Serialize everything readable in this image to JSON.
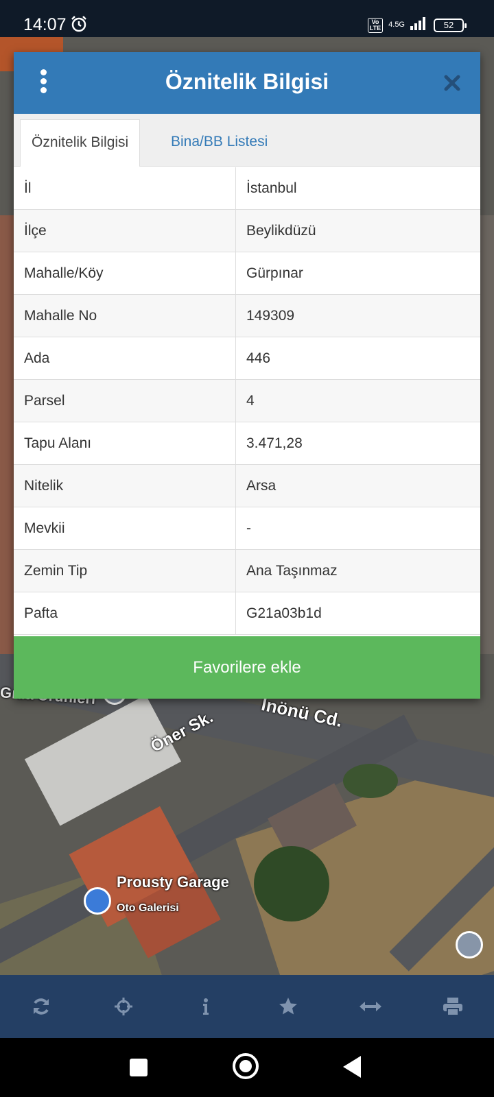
{
  "status_bar": {
    "time": "14:07",
    "alarm_icon": "alarm-clock-icon",
    "volte": "Vo\nLTE",
    "network": "4.5G",
    "battery": "52"
  },
  "map": {
    "labels": {
      "gida": "Gıda Ürünleri",
      "oner": "Öner Sk.",
      "inonu": "İnönü Cd.",
      "prousty": "Prousty Garage",
      "oto": "Oto Galerisi"
    }
  },
  "dialog": {
    "title": "Öznitelik Bilgisi",
    "menu_icon": "more-vertical-icon",
    "close_icon": "close-icon",
    "tabs": [
      {
        "label": "Öznitelik Bilgisi",
        "active": true
      },
      {
        "label": "Bina/BB Listesi",
        "active": false
      }
    ],
    "rows": [
      {
        "key": "İl",
        "value": "İstanbul"
      },
      {
        "key": "İlçe",
        "value": "Beylikdüzü"
      },
      {
        "key": "Mahalle/Köy",
        "value": "Gürpınar"
      },
      {
        "key": "Mahalle No",
        "value": "149309"
      },
      {
        "key": "Ada",
        "value": "446"
      },
      {
        "key": "Parsel",
        "value": "4"
      },
      {
        "key": "Tapu Alanı",
        "value": "3.471,28"
      },
      {
        "key": "Nitelik",
        "value": "Arsa"
      },
      {
        "key": "Mevkii",
        "value": "-"
      },
      {
        "key": "Zemin Tip",
        "value": "Ana Taşınmaz"
      },
      {
        "key": "Pafta",
        "value": "G21a03b1d"
      }
    ],
    "favorite_button": "Favorilere ekle"
  },
  "toolbar": {
    "icons": [
      "refresh-icon",
      "crosshair-icon",
      "info-icon",
      "star-icon",
      "measure-icon",
      "print-icon"
    ]
  },
  "colors": {
    "header": "#337ab7",
    "button": "#5cb85c",
    "toolbar": "#243f64"
  }
}
